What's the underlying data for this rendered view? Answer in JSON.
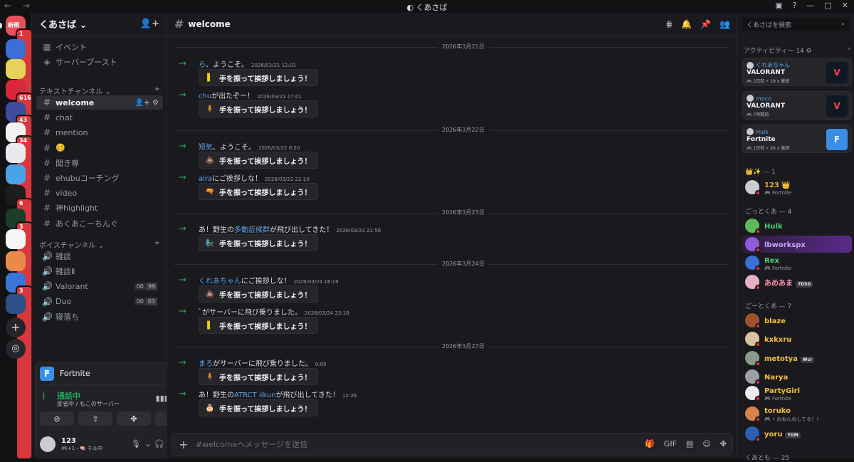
{
  "window": {
    "title": "くあさば",
    "nav": "← →"
  },
  "servers": [
    {
      "name": "新規",
      "badge": "1",
      "color": "#e8505b"
    },
    {
      "badge": "",
      "color": "#3b6fd6"
    },
    {
      "badge": "",
      "color": "#e5d25a"
    },
    {
      "badge": "616",
      "color": "#d9263a"
    },
    {
      "badge": "43",
      "color": "#3d4c9e"
    },
    {
      "badge": "34",
      "color": "#f2f2f2"
    },
    {
      "badge": "",
      "color": "#e9e9ee"
    },
    {
      "badge": "",
      "color": "#4aa3e8"
    },
    {
      "badge": "6",
      "color": "#1d1d1d"
    },
    {
      "badge": "3",
      "color": "#1b3d2a"
    },
    {
      "badge": "",
      "color": "#f5f5f5"
    },
    {
      "badge": "",
      "color": "#e88a4a"
    },
    {
      "badge": "3",
      "color": "#3a76d8"
    },
    {
      "badge": "",
      "color": "#2d4f8a"
    }
  ],
  "guild": {
    "name": "くあさば",
    "events": "イベント",
    "boost": "サーバーブースト"
  },
  "text_category": "テキストチャンネル",
  "text_channels": [
    "welcome",
    "chat",
    "mention",
    "🥴",
    "聞き専",
    "ehubuコーチング",
    "video",
    "神highlight",
    "あくあこーちんぐ"
  ],
  "voice_category": "ボイスチャンネル",
  "voice_channels": [
    {
      "name": "雑談",
      "c1": "",
      "c2": ""
    },
    {
      "name": "雑談Ⅱ",
      "c1": "",
      "c2": ""
    },
    {
      "name": "Valorant",
      "c1": "00",
      "c2": "99"
    },
    {
      "name": "Duo",
      "c1": "00",
      "c2": "03"
    },
    {
      "name": "寝落ち",
      "c1": "",
      "c2": ""
    }
  ],
  "voice": {
    "game": "Fortnite",
    "status": "通話中",
    "sub": "反省中 / もこのサーバー"
  },
  "user": {
    "name": "123",
    "status": "🎮+1・👒 チル中"
  },
  "header": {
    "channel": "welcome"
  },
  "dates": [
    "2026年3月21日",
    "2026年3月22日",
    "2026年3月23日",
    "2026年3月24日",
    "2026年3月27日"
  ],
  "messages": [
    {
      "name": "ら",
      "text": "、ようこそ。",
      "time": "2026/03/21 12:03",
      "emoji": "▌",
      "pre": ""
    },
    {
      "name": "chu",
      "text": "が出たぞー！",
      "time": "2026/03/21 17:01",
      "emoji": "🧍",
      "pre": ""
    },
    {
      "name": "短気",
      "text": "、ようこそ。",
      "time": "2026/03/22 0:20",
      "emoji": "💩",
      "pre": ""
    },
    {
      "name": "aira",
      "text": "にご挨拶しな！",
      "time": "2026/03/22 22:10",
      "emoji": "🔫",
      "pre": ""
    },
    {
      "name": "多動症候群",
      "text": "が飛び出してきた！",
      "time": "2026/03/23 21:56",
      "emoji": "🧞",
      "pre": "あ！野生の"
    },
    {
      "name": "くれあちゃん",
      "text": "にご挨拶しな！",
      "time": "2026/03/24 16:19",
      "emoji": "💩",
      "pre": ""
    },
    {
      "name": "",
      "text": "ﾞがサーバーに飛び乗りました。",
      "time": "2026/03/24 23:18",
      "emoji": "▌",
      "pre": ""
    },
    {
      "name": "まろ",
      "text": "がサーバーに飛び乗りました。",
      "time": "0:05",
      "emoji": "🧍",
      "pre": ""
    },
    {
      "name": "ATRCT iikun",
      "text": "が飛び出してきた！",
      "time": "12:26",
      "emoji": "🎂",
      "pre": "あ！野生の"
    }
  ],
  "wave_label": "手を振って挨拶しましょう！",
  "composer": {
    "placeholder": "#welcomeへメッセージを送信"
  },
  "members": {
    "search": "くあさばを検索",
    "activity": "アクティビティー 14 ⚙",
    "cards": [
      {
        "user": "くれあちゃん",
        "game": "VALORANT",
        "meta": "🎮 2日前  ⚡ 19 x 継続",
        "thumb": "V",
        "color": "#ff4655",
        "bg": "#0f1923"
      },
      {
        "user": "moco",
        "game": "VALORANT",
        "meta": "🎮 7時間前",
        "thumb": "V",
        "color": "#ff4655",
        "bg": "#0f1923"
      },
      {
        "user": "Hulk",
        "game": "Fortnite",
        "meta": "🎮 1日前  ⚡ 26 x 継続",
        "thumb": "F",
        "color": "#ffffff",
        "bg": "#3a8ee6"
      }
    ],
    "group1": "👑✨ — 1",
    "group2": "ごっとくあ — 4",
    "group3": "ごーとくあ — 7",
    "group4": "くあとも — 25",
    "list": [
      {
        "name": "123 👑",
        "sub": "🎮 Fortnite",
        "color": "#e8a33a",
        "tag": ""
      },
      {
        "name": "Hulk",
        "sub": "",
        "color": "#4fd17a",
        "tag": ""
      },
      {
        "name": "lbworkspx",
        "sub": "",
        "color": "#c7a4ff",
        "tag": ""
      },
      {
        "name": "Rex",
        "sub": "🎮 Fortnite",
        "color": "#4fd17a",
        "tag": ""
      },
      {
        "name": "あめあま",
        "sub": "",
        "color": "#ff8fb0",
        "tag": "7DSG"
      },
      {
        "name": "blaze",
        "sub": "",
        "color": "#f0c040",
        "tag": ""
      },
      {
        "name": "kxkxru",
        "sub": "",
        "color": "#f0c040",
        "tag": ""
      },
      {
        "name": "metotya",
        "sub": "",
        "color": "#f0c040",
        "tag": "Wcr"
      },
      {
        "name": "Narya",
        "sub": "",
        "color": "#f0c040",
        "tag": ""
      },
      {
        "name": "PartyGirl",
        "sub": "🎮 Fortnite",
        "color": "#f0c040",
        "tag": ""
      },
      {
        "name": "toruko",
        "sub": "🎮 • おねんねしてる！！",
        "color": "#f0c040",
        "tag": ""
      },
      {
        "name": "yoru",
        "sub": "",
        "color": "#f0c040",
        "tag": "YGM"
      }
    ]
  }
}
